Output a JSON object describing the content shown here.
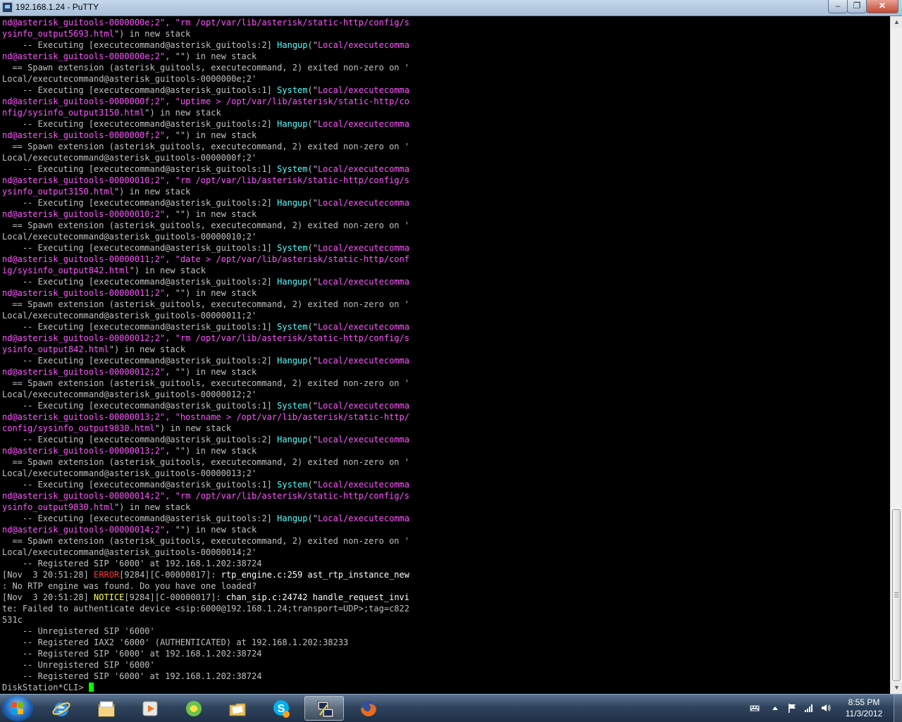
{
  "window": {
    "title": "192.168.1.24 - PuTTY",
    "minimize_label": "‒",
    "maximize_label": "❐",
    "close_label": "✕",
    "app_icon": "putty-icon"
  },
  "terminal": {
    "lines": [
      [
        [
          "nd@asterisk_guitools-0000000e;2\", \"rm /opt/var/lib/asterisk/static-http/config/s",
          "pink"
        ]
      ],
      [
        [
          "ysinfo_output5693.html",
          "pink"
        ],
        [
          "\") in new stack",
          "norm"
        ]
      ],
      [
        [
          "    -- Executing [executecommand@asterisk_guitools:2] ",
          "norm"
        ],
        [
          "Hangup",
          "cyan"
        ],
        [
          "(\"",
          "norm"
        ],
        [
          "Local/executecomma",
          "pink"
        ]
      ],
      [
        [
          "nd@asterisk_guitools-0000000e;2\"",
          "pink"
        ],
        [
          ", \"\") in new stack",
          "norm"
        ]
      ],
      [
        [
          "  == Spawn extension (asterisk_guitools, executecommand, 2) exited non-zero on '",
          "norm"
        ]
      ],
      [
        [
          "Local/executecommand@asterisk_guitools-0000000e;2'",
          "norm"
        ]
      ],
      [
        [
          "    -- Executing [executecommand@asterisk_guitools:1] ",
          "norm"
        ],
        [
          "System",
          "cyan"
        ],
        [
          "(\"",
          "norm"
        ],
        [
          "Local/executecomma",
          "pink"
        ]
      ],
      [
        [
          "nd@asterisk_guitools-0000000f;2\", \"uptime > /opt/var/lib/asterisk/static-http/co",
          "pink"
        ]
      ],
      [
        [
          "nfig/sysinfo_output3150.html",
          "pink"
        ],
        [
          "\") in new stack",
          "norm"
        ]
      ],
      [
        [
          "    -- Executing [executecommand@asterisk_guitools:2] ",
          "norm"
        ],
        [
          "Hangup",
          "cyan"
        ],
        [
          "(\"",
          "norm"
        ],
        [
          "Local/executecomma",
          "pink"
        ]
      ],
      [
        [
          "nd@asterisk_guitools-0000000f;2\"",
          "pink"
        ],
        [
          ", \"\") in new stack",
          "norm"
        ]
      ],
      [
        [
          "  == Spawn extension (asterisk_guitools, executecommand, 2) exited non-zero on '",
          "norm"
        ]
      ],
      [
        [
          "Local/executecommand@asterisk_guitools-0000000f;2'",
          "norm"
        ]
      ],
      [
        [
          "    -- Executing [executecommand@asterisk_guitools:1] ",
          "norm"
        ],
        [
          "System",
          "cyan"
        ],
        [
          "(\"",
          "norm"
        ],
        [
          "Local/executecomma",
          "pink"
        ]
      ],
      [
        [
          "nd@asterisk_guitools-00000010;2\", \"rm /opt/var/lib/asterisk/static-http/config/s",
          "pink"
        ]
      ],
      [
        [
          "ysinfo_output3150.html",
          "pink"
        ],
        [
          "\") in new stack",
          "norm"
        ]
      ],
      [
        [
          "    -- Executing [executecommand@asterisk_guitools:2] ",
          "norm"
        ],
        [
          "Hangup",
          "cyan"
        ],
        [
          "(\"",
          "norm"
        ],
        [
          "Local/executecomma",
          "pink"
        ]
      ],
      [
        [
          "nd@asterisk_guitools-00000010;2\"",
          "pink"
        ],
        [
          ", \"\") in new stack",
          "norm"
        ]
      ],
      [
        [
          "  == Spawn extension (asterisk_guitools, executecommand, 2) exited non-zero on '",
          "norm"
        ]
      ],
      [
        [
          "Local/executecommand@asterisk_guitools-00000010;2'",
          "norm"
        ]
      ],
      [
        [
          "    -- Executing [executecommand@asterisk_guitools:1] ",
          "norm"
        ],
        [
          "System",
          "cyan"
        ],
        [
          "(\"",
          "norm"
        ],
        [
          "Local/executecomma",
          "pink"
        ]
      ],
      [
        [
          "nd@asterisk_guitools-00000011;2\", \"date > /opt/var/lib/asterisk/static-http/conf",
          "pink"
        ]
      ],
      [
        [
          "ig/sysinfo_output842.html",
          "pink"
        ],
        [
          "\") in new stack",
          "norm"
        ]
      ],
      [
        [
          "    -- Executing [executecommand@asterisk_guitools:2] ",
          "norm"
        ],
        [
          "Hangup",
          "cyan"
        ],
        [
          "(\"",
          "norm"
        ],
        [
          "Local/executecomma",
          "pink"
        ]
      ],
      [
        [
          "nd@asterisk_guitools-00000011;2\"",
          "pink"
        ],
        [
          ", \"\") in new stack",
          "norm"
        ]
      ],
      [
        [
          "  == Spawn extension (asterisk_guitools, executecommand, 2) exited non-zero on '",
          "norm"
        ]
      ],
      [
        [
          "Local/executecommand@asterisk_guitools-00000011;2'",
          "norm"
        ]
      ],
      [
        [
          "    -- Executing [executecommand@asterisk_guitools:1] ",
          "norm"
        ],
        [
          "System",
          "cyan"
        ],
        [
          "(\"",
          "norm"
        ],
        [
          "Local/executecomma",
          "pink"
        ]
      ],
      [
        [
          "nd@asterisk_guitools-00000012;2\", \"rm /opt/var/lib/asterisk/static-http/config/s",
          "pink"
        ]
      ],
      [
        [
          "ysinfo_output842.html",
          "pink"
        ],
        [
          "\") in new stack",
          "norm"
        ]
      ],
      [
        [
          "    -- Executing [executecommand@asterisk_guitools:2] ",
          "norm"
        ],
        [
          "Hangup",
          "cyan"
        ],
        [
          "(\"",
          "norm"
        ],
        [
          "Local/executecomma",
          "pink"
        ]
      ],
      [
        [
          "nd@asterisk_guitools-00000012;2\"",
          "pink"
        ],
        [
          ", \"\") in new stack",
          "norm"
        ]
      ],
      [
        [
          "  == Spawn extension (asterisk_guitools, executecommand, 2) exited non-zero on '",
          "norm"
        ]
      ],
      [
        [
          "Local/executecommand@asterisk_guitools-00000012;2'",
          "norm"
        ]
      ],
      [
        [
          "    -- Executing [executecommand@asterisk_guitools:1] ",
          "norm"
        ],
        [
          "System",
          "cyan"
        ],
        [
          "(\"",
          "norm"
        ],
        [
          "Local/executecomma",
          "pink"
        ]
      ],
      [
        [
          "nd@asterisk_guitools-00000013;2\", \"hostname > /opt/var/lib/asterisk/static-http/",
          "pink"
        ]
      ],
      [
        [
          "config/sysinfo_output9830.html",
          "pink"
        ],
        [
          "\") in new stack",
          "norm"
        ]
      ],
      [
        [
          "    -- Executing [executecommand@asterisk_guitools:2] ",
          "norm"
        ],
        [
          "Hangup",
          "cyan"
        ],
        [
          "(\"",
          "norm"
        ],
        [
          "Local/executecomma",
          "pink"
        ]
      ],
      [
        [
          "nd@asterisk_guitools-00000013;2\"",
          "pink"
        ],
        [
          ", \"\") in new stack",
          "norm"
        ]
      ],
      [
        [
          "  == Spawn extension (asterisk_guitools, executecommand, 2) exited non-zero on '",
          "norm"
        ]
      ],
      [
        [
          "Local/executecommand@asterisk_guitools-00000013;2'",
          "norm"
        ]
      ],
      [
        [
          "    -- Executing [executecommand@asterisk_guitools:1] ",
          "norm"
        ],
        [
          "System",
          "cyan"
        ],
        [
          "(\"",
          "norm"
        ],
        [
          "Local/executecomma",
          "pink"
        ]
      ],
      [
        [
          "nd@asterisk_guitools-00000014;2\", \"rm /opt/var/lib/asterisk/static-http/config/s",
          "pink"
        ]
      ],
      [
        [
          "ysinfo_output9830.html",
          "pink"
        ],
        [
          "\") in new stack",
          "norm"
        ]
      ],
      [
        [
          "    -- Executing [executecommand@asterisk_guitools:2] ",
          "norm"
        ],
        [
          "Hangup",
          "cyan"
        ],
        [
          "(\"",
          "norm"
        ],
        [
          "Local/executecomma",
          "pink"
        ]
      ],
      [
        [
          "nd@asterisk_guitools-00000014;2\"",
          "pink"
        ],
        [
          ", \"\") in new stack",
          "norm"
        ]
      ],
      [
        [
          "  == Spawn extension (asterisk_guitools, executecommand, 2) exited non-zero on '",
          "norm"
        ]
      ],
      [
        [
          "Local/executecommand@asterisk_guitools-00000014;2'",
          "norm"
        ]
      ],
      [
        [
          "    -- Registered SIP '6000' at 192.168.1.202:38724",
          "norm"
        ]
      ],
      [
        [
          "[Nov  3 20:51:28] ",
          "norm"
        ],
        [
          "ERROR",
          "red"
        ],
        [
          "[9284][C-00000017]: ",
          "norm"
        ],
        [
          "rtp_engine.c:259 ast_rtp_instance_new",
          "white"
        ]
      ],
      [
        [
          ": No RTP engine was found. Do you have one loaded?",
          "norm"
        ]
      ],
      [
        [
          "[Nov  3 20:51:28] ",
          "norm"
        ],
        [
          "NOTICE",
          "yellow"
        ],
        [
          "[9284][C-00000017]: ",
          "norm"
        ],
        [
          "chan_sip.c:24742 handle_request_invi",
          "white"
        ]
      ],
      [
        [
          "te: Failed to authenticate device <sip:6000@192.168.1.24;transport=UDP>;tag=c822",
          "norm"
        ]
      ],
      [
        [
          "531c",
          "norm"
        ]
      ],
      [
        [
          "    -- Unregistered SIP '6000'",
          "norm"
        ]
      ],
      [
        [
          "    -- Registered IAX2 '6000' (AUTHENTICATED) at 192.168.1.202:38233",
          "norm"
        ]
      ],
      [
        [
          "    -- Registered SIP '6000' at 192.168.1.202:38724",
          "norm"
        ]
      ],
      [
        [
          "    -- Unregistered SIP '6000'",
          "norm"
        ]
      ],
      [
        [
          "    -- Registered SIP '6000' at 192.168.1.202:38724",
          "norm"
        ]
      ]
    ],
    "prompt": "DiskStation*CLI> "
  },
  "scrollbar": {
    "up_arrow": "▲",
    "down_arrow": "▼"
  },
  "taskbar": {
    "start_icon": "windows-start-icon",
    "apps": [
      {
        "name": "internet-explorer-icon",
        "active": false
      },
      {
        "name": "file-explorer-icon",
        "active": false
      },
      {
        "name": "media-player-icon",
        "active": false
      },
      {
        "name": "green-app-icon",
        "active": false
      },
      {
        "name": "folder-icon",
        "active": false
      },
      {
        "name": "skype-icon",
        "active": false
      },
      {
        "name": "putty-icon",
        "active": true
      },
      {
        "name": "firefox-icon",
        "active": false
      }
    ],
    "tray_icons": [
      "keyboard-icon",
      "show-hidden-icons",
      "action-center-flag-icon",
      "network-signal-icon",
      "volume-icon"
    ],
    "time": "8:55 PM",
    "date": "11/3/2012"
  },
  "colors": {
    "terminal_bg": "#000000",
    "terminal_text": "#c0c0c0",
    "pink": "#ff55ff",
    "cyan": "#55ffff",
    "red": "#ff3333",
    "cursor": "#00ff00"
  }
}
